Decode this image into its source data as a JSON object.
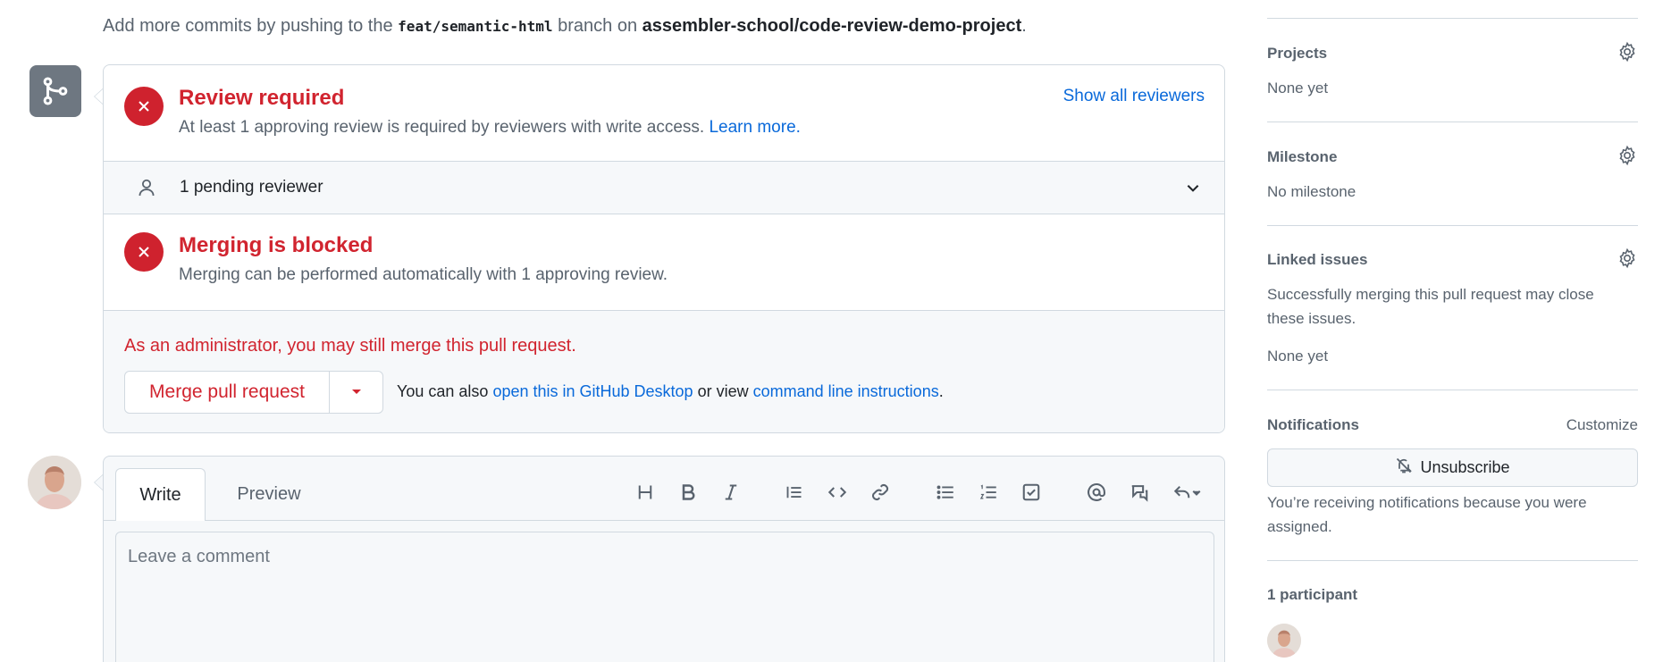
{
  "hint": {
    "prefix": "Add more commits by pushing to the",
    "branch": "feat/semantic-html",
    "middle": "branch on",
    "repo": "assembler-school/code-review-demo-project",
    "suffix": "."
  },
  "review": {
    "title": "Review required",
    "subtitle": "At least 1 approving review is required by reviewers with write access.",
    "learn_more": "Learn more.",
    "show_all": "Show all reviewers",
    "pending": "1 pending reviewer"
  },
  "blocked": {
    "title": "Merging is blocked",
    "subtitle": "Merging can be performed automatically with 1 approving review."
  },
  "admin": {
    "warning": "As an administrator, you may still merge this pull request.",
    "merge_label": "Merge pull request",
    "also_prefix": "You can also",
    "desktop_link": "open this in GitHub Desktop",
    "or_view": "or view",
    "cli_link": "command line instructions",
    "period": "."
  },
  "comment": {
    "tab_write": "Write",
    "tab_preview": "Preview",
    "placeholder": "Leave a comment"
  },
  "sidebar": {
    "projects": {
      "title": "Projects",
      "value": "None yet"
    },
    "milestone": {
      "title": "Milestone",
      "value": "No milestone"
    },
    "linked": {
      "title": "Linked issues",
      "desc": "Successfully merging this pull request may close these issues.",
      "value": "None yet"
    },
    "notifications": {
      "title": "Notifications",
      "customize": "Customize",
      "unsubscribe": "Unsubscribe",
      "desc": "You’re receiving notifications because you were assigned."
    },
    "participants": {
      "title": "1 participant"
    }
  },
  "colors": {
    "danger": "#d1242f",
    "link": "#0969da",
    "muted": "#59636e",
    "border": "#d1d9e0"
  }
}
